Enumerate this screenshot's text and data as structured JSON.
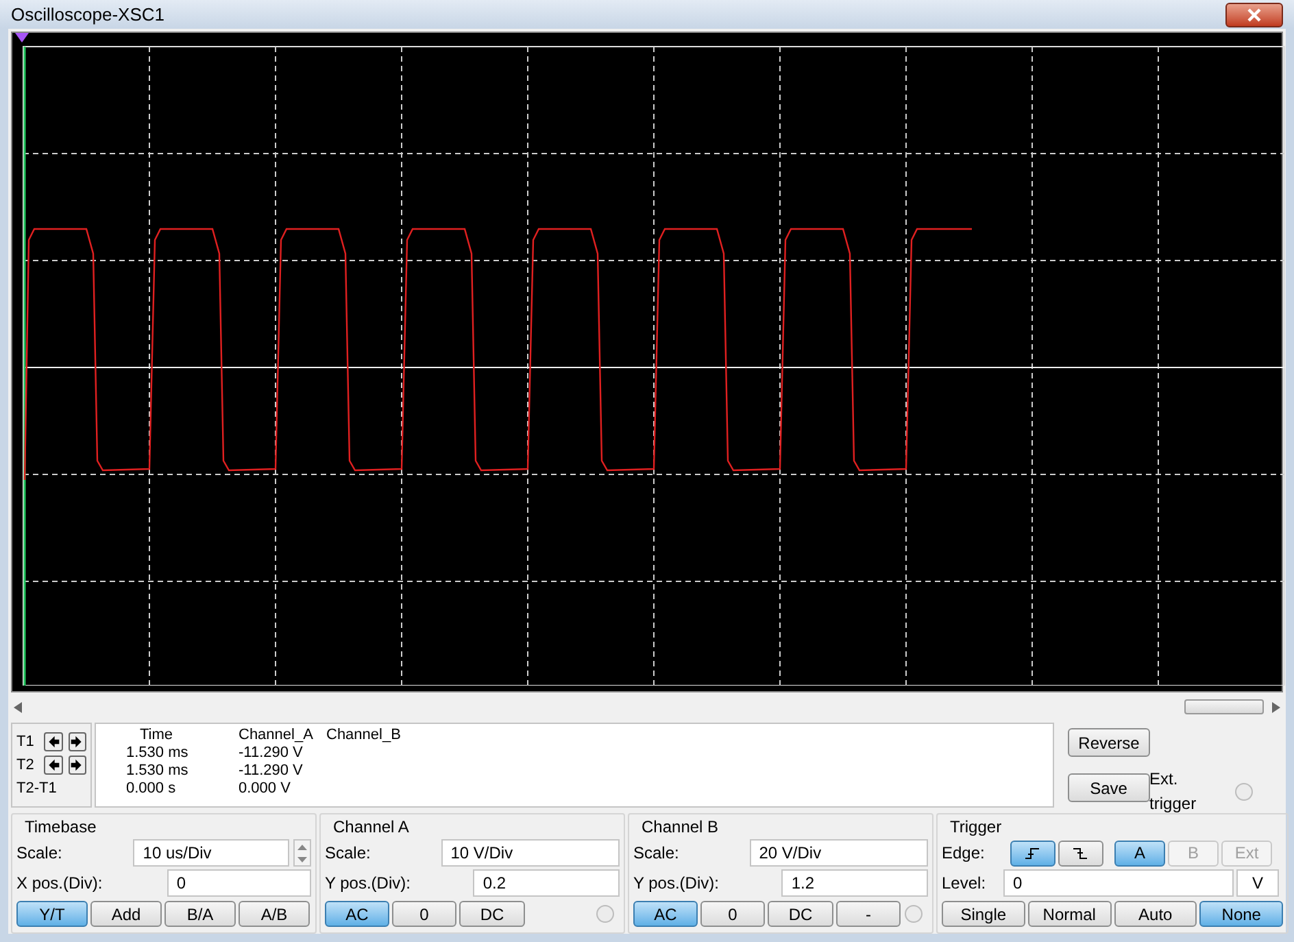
{
  "window": {
    "title": "Oscilloscope-XSC1"
  },
  "readout": {
    "headers": [
      "Time",
      "Channel_A",
      "Channel_B"
    ],
    "rows": [
      {
        "label": "T1",
        "time": "1.530 ms",
        "channel_a": "-11.290 V",
        "arrows": true
      },
      {
        "label": "T2",
        "time": "1.530 ms",
        "channel_a": "-11.290 V",
        "arrows": true
      },
      {
        "label": "T2-T1",
        "time": "0.000 s",
        "channel_a": "0.000 V",
        "arrows": false
      }
    ]
  },
  "side_buttons": [
    "Reverse",
    "Save"
  ],
  "ext_trigger": {
    "label": "Ext. trigger",
    "selected": false
  },
  "timebase": {
    "title": "Timebase",
    "scale_label": "Scale:",
    "scale_value": "10 us/Div",
    "pos_label": "X pos.(Div):",
    "pos_value": "0",
    "modes": [
      {
        "label": "Y/T",
        "selected": true
      },
      {
        "label": "Add",
        "selected": false
      },
      {
        "label": "B/A",
        "selected": false
      },
      {
        "label": "A/B",
        "selected": false
      }
    ]
  },
  "channels": [
    {
      "title": "Channel A",
      "scale_label": "Scale:",
      "scale_value": "10  V/Div",
      "pos_label": "Y pos.(Div):",
      "pos_value": "0.2",
      "coupling": [
        {
          "label": "AC",
          "selected": true
        },
        {
          "label": "0",
          "selected": false
        },
        {
          "label": "DC",
          "selected": false
        }
      ],
      "radio_selected": false
    },
    {
      "title": "Channel B",
      "scale_label": "Scale:",
      "scale_value": "20  V/Div",
      "pos_label": "Y pos.(Div):",
      "pos_value": "1.2",
      "coupling": [
        {
          "label": "AC",
          "selected": true
        },
        {
          "label": "0",
          "selected": false
        },
        {
          "label": "DC",
          "selected": false
        },
        {
          "label": "-",
          "selected": false
        }
      ],
      "radio_selected": false
    }
  ],
  "trigger": {
    "title": "Trigger",
    "edge_label": "Edge:",
    "edges": [
      {
        "kind": "rising",
        "selected": true
      },
      {
        "kind": "falling",
        "selected": false
      }
    ],
    "sources": [
      {
        "label": "A",
        "selected": true,
        "disabled": false
      },
      {
        "label": "B",
        "selected": false,
        "disabled": true
      },
      {
        "label": "Ext",
        "selected": false,
        "disabled": true
      }
    ],
    "level_label": "Level:",
    "level_value": "0",
    "level_unit": "V",
    "modes": [
      {
        "label": "Single",
        "selected": false
      },
      {
        "label": "Normal",
        "selected": false
      },
      {
        "label": "Auto",
        "selected": false
      },
      {
        "label": "None",
        "selected": true
      }
    ]
  }
}
